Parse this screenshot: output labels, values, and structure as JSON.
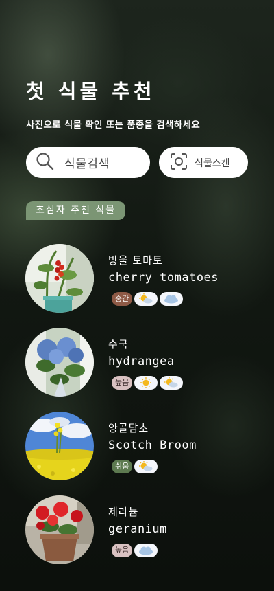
{
  "header": {
    "title": "첫 식물 추천",
    "subtitle": "사진으로 식물 확인 또는 품종을 검색하세요"
  },
  "search": {
    "label": "식물검색",
    "icon": "search-icon"
  },
  "scan": {
    "label": "식물스캔",
    "icon": "scan-icon"
  },
  "section": {
    "label": "초심자 추천 식물"
  },
  "plants": [
    {
      "name_ko": "방울 토마토",
      "name_en": "cherry tomatoes",
      "difficulty": "중간",
      "weather": [
        "partly-sunny-icon",
        "cloud-icon"
      ]
    },
    {
      "name_ko": "수국",
      "name_en": "hydrangea",
      "difficulty": "높음",
      "weather": [
        "sun-icon",
        "partly-sunny-icon"
      ]
    },
    {
      "name_ko": "양골담초",
      "name_en": "Scotch Broom",
      "difficulty": "쉬움",
      "weather": [
        "partly-sunny-icon"
      ]
    },
    {
      "name_ko": "제라늄",
      "name_en": "geranium",
      "difficulty": "높음",
      "weather": [
        "cloud-icon"
      ]
    }
  ],
  "colors": {
    "section_tag": "#7b9574",
    "difficulty_mid": "#8e5a46",
    "difficulty_high": "#d9c1c1",
    "difficulty_easy": "#5d7a50"
  }
}
